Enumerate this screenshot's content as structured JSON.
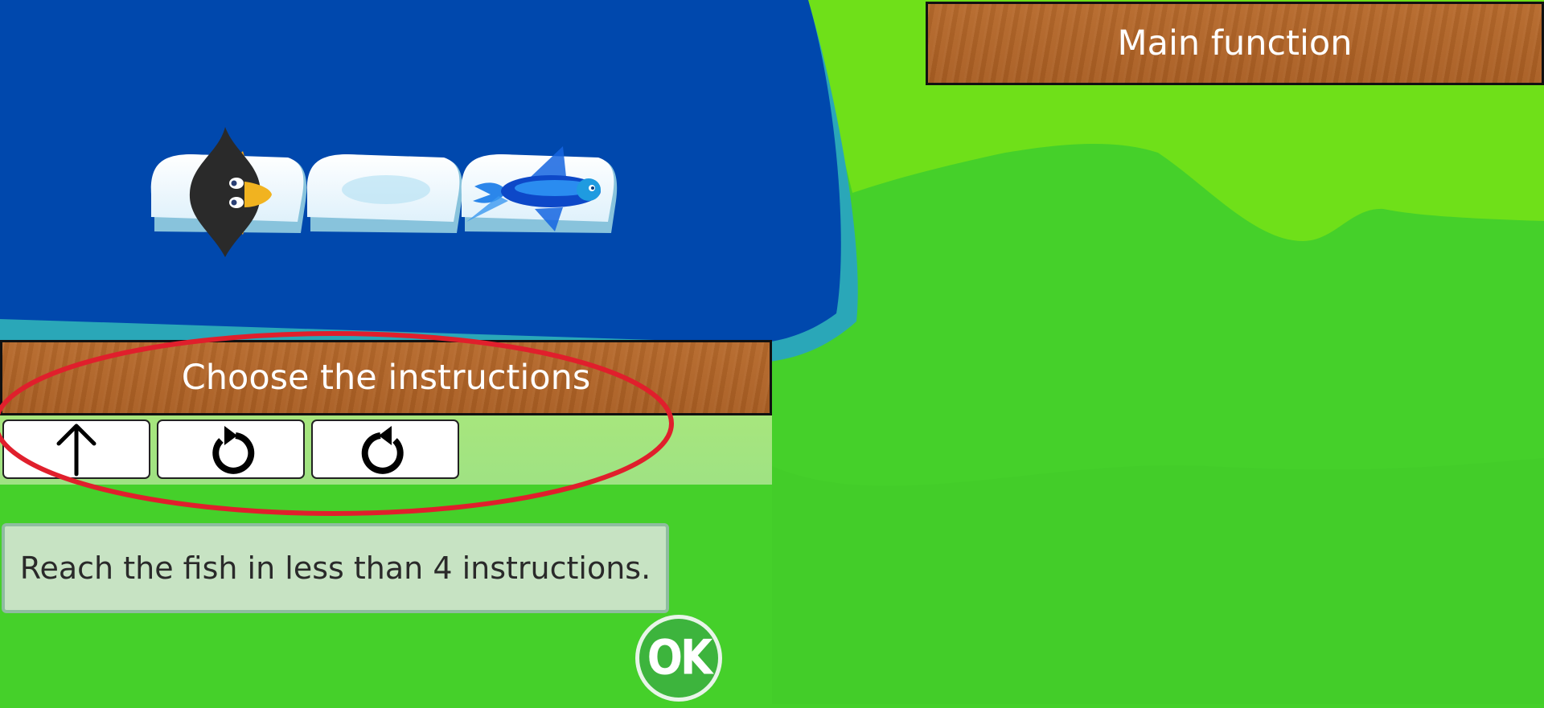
{
  "main_function": {
    "title": "Main function"
  },
  "instructions": {
    "title": "Choose the instructions",
    "buttons": [
      {
        "name": "forward",
        "icon": "arrow-up-icon"
      },
      {
        "name": "turn-left",
        "icon": "rotate-ccw-icon"
      },
      {
        "name": "turn-right",
        "icon": "rotate-cw-icon"
      }
    ]
  },
  "hint": {
    "text": "Reach the fish in less than 4 instructions."
  },
  "ok_button": {
    "label": "OK",
    "color": "#3db43d"
  },
  "scene": {
    "tiles": [
      {
        "content": "penguin",
        "facing": "right"
      },
      {
        "content": "empty"
      },
      {
        "content": "fish"
      }
    ]
  },
  "colors": {
    "water": "#0048ad",
    "shore": "#2aa7b8",
    "grass_light": "#6fe019",
    "grass": "#45d02a",
    "wood": "#b0652a",
    "highlight": "#e01f2c"
  }
}
